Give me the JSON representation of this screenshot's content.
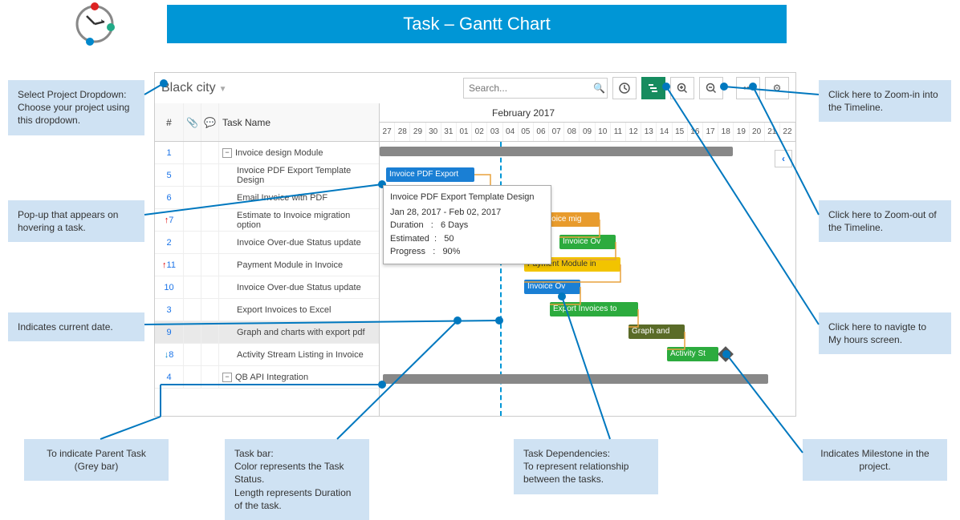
{
  "banner_title": "Task – Gantt Chart",
  "project_name": "Black city",
  "search_placeholder": "Search...",
  "month_label": "February 2017",
  "days": [
    "27",
    "28",
    "29",
    "30",
    "31",
    "01",
    "02",
    "03",
    "04",
    "05",
    "06",
    "07",
    "08",
    "09",
    "10",
    "11",
    "12",
    "13",
    "14",
    "15",
    "16",
    "17",
    "18",
    "19",
    "20",
    "21",
    "22"
  ],
  "cols": {
    "num": "#",
    "name": "Task Name"
  },
  "rows": [
    {
      "n": "1",
      "name": "Invoice design Module",
      "parent": true
    },
    {
      "n": "5",
      "name": "Invoice PDF Export Template Design"
    },
    {
      "n": "6",
      "name": "Email Invoice with PDF"
    },
    {
      "n": "7",
      "name": "Estimate to Invoice migration option",
      "arrow": "up"
    },
    {
      "n": "2",
      "name": "Invoice Over-due Status update"
    },
    {
      "n": "11",
      "name": "Payment Module in Invoice",
      "arrow": "up"
    },
    {
      "n": "10",
      "name": "Invoice Over-due Status update"
    },
    {
      "n": "3",
      "name": "Export Invoices to Excel"
    },
    {
      "n": "9",
      "name": "Graph and charts with export pdf",
      "hl": true
    },
    {
      "n": "8",
      "name": "Activity Stream Listing in Invoice",
      "arrow": "down"
    },
    {
      "n": "4",
      "name": "QB API Integration",
      "parent": true
    }
  ],
  "bars": {
    "b_pdf": "Invoice PDF Export",
    "b_est": "Estimate to Invoice mig",
    "b_ovr": "Invoice Ov",
    "b_pay": "Payment Module in",
    "b_ov2": "Invoice Ov",
    "b_exp": "Export Invoices to",
    "b_graph": "Graph and",
    "b_act": "Activity St"
  },
  "tooltip": {
    "title": "Invoice PDF Export Template Design",
    "range": "Jan 28, 2017   -    Feb 02, 2017",
    "dur_l": "Duration",
    "dur_v": "6 Days",
    "est_l": "Estimated",
    "est_v": "50",
    "prog_l": "Progress",
    "prog_v": "90%"
  },
  "callouts": {
    "c1": "Select Project Dropdown: Choose your project using this dropdown.",
    "c2": "Pop-up that appears on hovering a task.",
    "c3": "Indicates current date.",
    "c4": "To indicate Parent Task (Grey bar)",
    "c5": "Task bar:\n    Color represents the Task Status.\nLength represents  Duration of the task.",
    "c6": "Task Dependencies:\nTo represent relationship between the tasks.",
    "c7": "Indicates Milestone in the project.",
    "c8": "Click here to Zoom-in into the Timeline.",
    "c9": "Click here to Zoom-out of the Timeline.",
    "c10": "Click here to navigte to My hours screen."
  }
}
